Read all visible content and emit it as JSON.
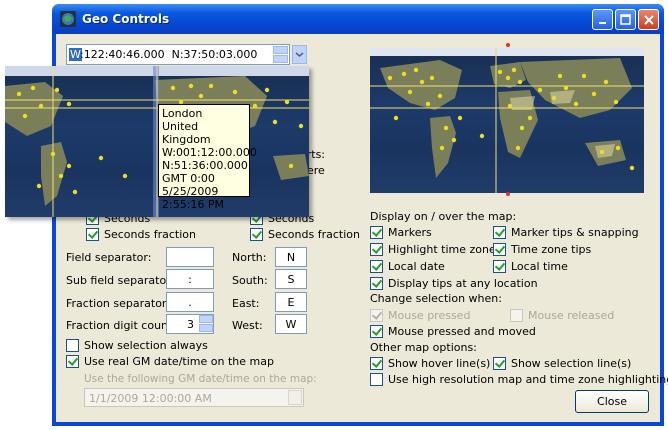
{
  "window": {
    "title": "Geo Controls"
  },
  "coord": {
    "prefix": "W",
    "rest": ":122:40:46.000  N:37:50:03.000"
  },
  "tooltip": {
    "lines": [
      "London",
      "United Kingdom",
      "W:001:12:00.000",
      "N:51:36:00.000",
      "GMT 0:00",
      "5/25/2009",
      "2:55:16 PM"
    ]
  },
  "partial": {
    "parts": "arts:",
    "here": "here"
  },
  "seconds_left": {
    "seconds": "Seconds",
    "fraction": "Seconds fraction"
  },
  "seconds_right": {
    "seconds": "Seconds",
    "fraction": "Seconds fraction"
  },
  "separators": [
    {
      "label": "Field separator:",
      "value": ""
    },
    {
      "label": "Sub field separator:",
      "value": ":"
    },
    {
      "label": "Fraction separator:",
      "value": "."
    },
    {
      "label": "Fraction digit count:",
      "value": "3"
    }
  ],
  "directions": [
    {
      "label": "North:",
      "value": "N"
    },
    {
      "label": "South:",
      "value": "S"
    },
    {
      "label": "East:",
      "value": "E"
    },
    {
      "label": "West:",
      "value": "W"
    }
  ],
  "left_options": {
    "show_sel": "Show selection always",
    "use_gm": "Use real GM date/time on the map",
    "following": "Use the following GM date/time on the map:",
    "date_value": "1/1/2009 12:00:00 AM"
  },
  "display": {
    "header": "Display on / over the map:",
    "markers": "Markers",
    "marker_tips": "Marker tips & snapping",
    "highlight": "Highlight time zones",
    "tz_tips": "Time zone tips",
    "local_date": "Local date",
    "local_time": "Local time",
    "display_tips": "Display tips at any location"
  },
  "change": {
    "header": "Change selection when:",
    "pressed": "Mouse pressed",
    "released": "Mouse released",
    "pressed_moved": "Mouse pressed and moved"
  },
  "other": {
    "header": "Other map options:",
    "hover": "Show hover line(s)",
    "sel_line": "Show selection line(s)",
    "hires": "Use high resolution map and time zone highlighting"
  },
  "close_label": "Close",
  "colors": {
    "marker": "#e8e020",
    "title_blue": "#0a58e0",
    "dialog": "#ece9d8"
  }
}
